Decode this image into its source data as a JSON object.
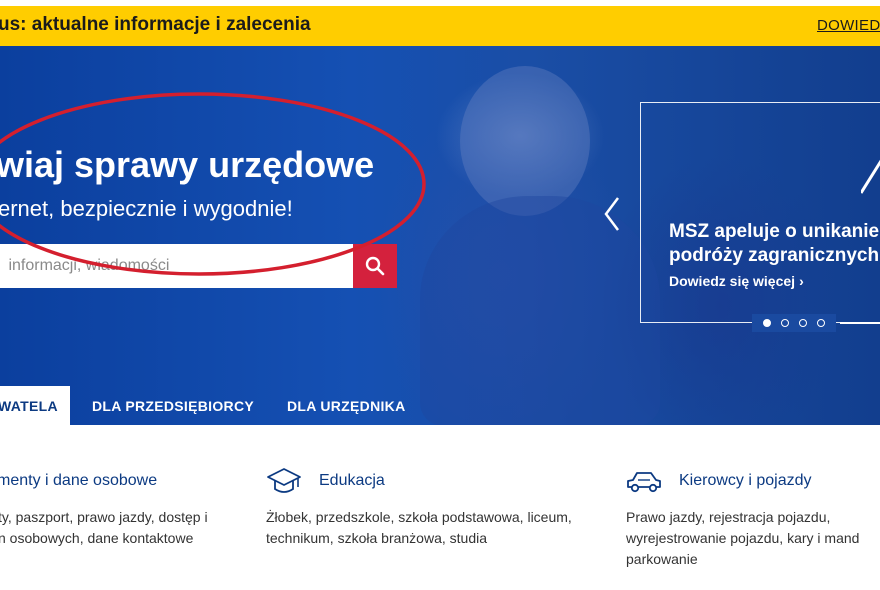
{
  "alert": {
    "text": "us: aktualne informacje i zalecenia",
    "link_label": "DOWIEDZ"
  },
  "hero": {
    "title": "wiaj sprawy urzędowe",
    "subtitle": "ernet, bezpiecznie i wygodnie!",
    "search_placeholder": " informacji, wiadomości"
  },
  "carousel": {
    "title_line1": "MSZ apeluje o unikanie",
    "title_line2": "podróży zagranicznych",
    "link_label": "Dowiedz się więcej",
    "active_slide": 1,
    "total_slides": 4
  },
  "tabs": [
    {
      "label": "WATELA"
    },
    {
      "label": "DLA PRZEDSIĘBIORCY"
    },
    {
      "label": "DLA URZĘDNIKA"
    }
  ],
  "categories": [
    {
      "title": "menty i dane osobowe",
      "desc_line1": "ty, paszport, prawo jazdy, dostęp i",
      "desc_line2": "n osobowych, dane kontaktowe",
      "desc_line3": "",
      "icon": "id-card-icon"
    },
    {
      "title": "Edukacja",
      "desc_line1": "Żłobek, przedszkole, szkoła podstawowa, liceum,",
      "desc_line2": "technikum, szkoła branżowa, studia",
      "desc_line3": "",
      "icon": "graduation-cap-icon"
    },
    {
      "title": "Kierowcy i pojazdy",
      "desc_line1": "Prawo jazdy, rejestracja pojazdu,",
      "desc_line2": "wyrejestrowanie pojazdu, kary i mand",
      "desc_line3": "parkowanie",
      "icon": "car-icon"
    }
  ],
  "colors": {
    "alert_bg": "#ffcd00",
    "hero_blue": "#1550b3",
    "accent_red": "#d4213d",
    "link_blue": "#0c3a82",
    "annotation_red": "#d41f2e"
  }
}
